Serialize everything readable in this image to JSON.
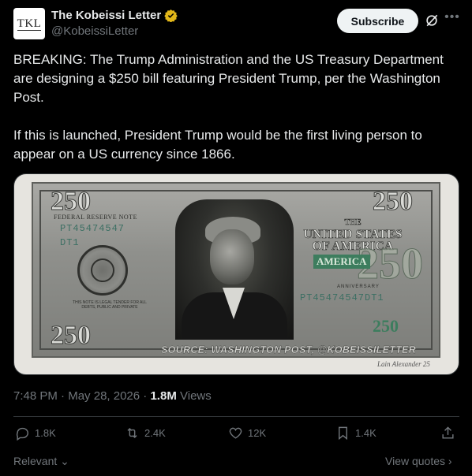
{
  "author": {
    "avatar_text": "TKL",
    "name": "The Kobeissi Letter",
    "handle": "@KobeissiLetter"
  },
  "header": {
    "subscribe_label": "Subscribe"
  },
  "tweet": {
    "paragraph1": "BREAKING: The Trump Administration and the US Treasury Department are designing a $250 bill featuring President Trump, per the Washington Post.",
    "paragraph2": "If this is launched, President Trump would be the first living person to appear on a US currency since 1866."
  },
  "media": {
    "denomination": "250",
    "note_label": "FEDERAL RESERVE NOTE",
    "serial_left": "PT45474547",
    "district": "DT1",
    "serial_right": "PT45474547DT1",
    "country_line1": "THE",
    "country_line2": "UNITED STATES",
    "country_line3": "OF AMERICA",
    "america_badge": "AMERICA",
    "anniversary": "ANNIVERSARY",
    "legal_tender": "THIS NOTE IS LEGAL TENDER FOR ALL DEBTS, PUBLIC AND PRIVATE",
    "source_caption": "SOURCE: WASHINGTON POST, @KOBEISSILETTER",
    "artist_signature": "Lain Alexander 25"
  },
  "meta": {
    "time": "7:48 PM",
    "separator": "·",
    "date": "May 28, 2026",
    "views_count": "1.8M",
    "views_label": "Views"
  },
  "actions": {
    "replies": "1.8K",
    "reposts": "2.4K",
    "likes": "12K",
    "bookmarks": "1.4K"
  },
  "footer": {
    "relevant_label": "Relevant",
    "view_quotes_label": "View quotes"
  },
  "colors": {
    "background": "#000000",
    "text_primary": "#e7e9ea",
    "text_secondary": "#71767b",
    "verified_badge": "#e2b719",
    "subscribe_bg": "#eff3f4"
  }
}
